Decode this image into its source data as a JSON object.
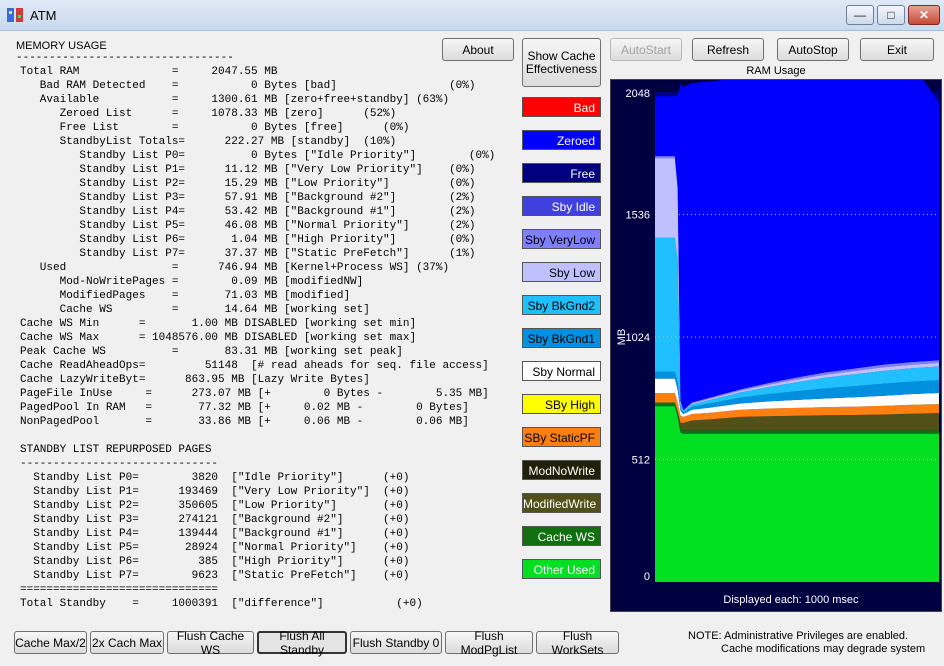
{
  "window": {
    "title": "ATM",
    "min_label": "—",
    "max_label": "□",
    "close_label": "✕"
  },
  "memory": {
    "title": "MEMORY USAGE",
    "underline": "---------------------------------",
    "lines": [
      "Total RAM              =     2047.55 MB",
      "   Bad RAM Detected    =           0 Bytes [bad]                 (0%)",
      "   Available           =     1300.61 MB [zero+free+standby] (63%)",
      "      Zeroed List      =     1078.33 MB [zero]      (52%)",
      "      Free List        =           0 Bytes [free]      (0%)",
      "      StandbyList Totals=      222.27 MB [standby]  (10%)",
      "         Standby List P0=          0 Bytes [\"Idle Priority\"]        (0%)",
      "         Standby List P1=      11.12 MB [\"Very Low Priority\"]    (0%)",
      "         Standby List P2=      15.29 MB [\"Low Priority\"]         (0%)",
      "         Standby List P3=      57.91 MB [\"Background #2\"]        (2%)",
      "         Standby List P4=      53.42 MB [\"Background #1\"]        (2%)",
      "         Standby List P5=      46.08 MB [\"Normal Priority\"]      (2%)",
      "         Standby List P6=       1.04 MB [\"High Priority\"]        (0%)",
      "         Standby List P7=      37.37 MB [\"Static PreFetch\"]      (1%)",
      "   Used                =      746.94 MB [Kernel+Process WS] (37%)",
      "      Mod-NoWritePages =        0.09 MB [modifiedNW]",
      "      ModifiedPages    =       71.03 MB [modified]",
      "      Cache WS         =       14.64 MB [working set]",
      "Cache WS Min      =       1.00 MB DISABLED [working set min]",
      "Cache WS Max      = 1048576.00 MB DISABLED [working set max]",
      "Peak Cache WS          =       83.31 MB [working set peak]",
      "Cache ReadAheadOps=         51148  [# read aheads for seq. file access]",
      "Cache LazyWriteByt=      863.95 MB [Lazy Write Bytes]",
      "PageFile InUse     =      273.07 MB [+        0 Bytes -        5.35 MB]",
      "PagedPool In RAM   =       77.32 MB [+     0.02 MB -        0 Bytes]",
      "NonPagedPool       =       33.86 MB [+     0.06 MB -        0.06 MB]"
    ]
  },
  "repurposed": {
    "title": "STANDBY LIST REPURPOSED PAGES",
    "underline": "------------------------------",
    "rows": [
      "  Standby List P0=        3820  [\"Idle Priority\"]      (+0)",
      "  Standby List P1=      193469  [\"Very Low Priority\"]  (+0)",
      "  Standby List P2=      350605  [\"Low Priority\"]       (+0)",
      "  Standby List P3=      274121  [\"Background #2\"]      (+0)",
      "  Standby List P4=      139444  [\"Background #1\"]      (+0)",
      "  Standby List P5=       28924  [\"Normal Priority\"]    (+0)",
      "  Standby List P6=         385  [\"High Priority\"]      (+0)",
      "  Standby List P7=        9623  [\"Static PreFetch\"]    (+0)"
    ],
    "separator": "==============================",
    "total": "Total Standby    =     1000391  [\"difference\"]           (+0)"
  },
  "buttons": {
    "about": "About",
    "show_cache": "Show Cache Effectiveness",
    "autostart": "AutoStart",
    "refresh": "Refresh",
    "autostop": "AutoStop",
    "exit": "Exit"
  },
  "legend": [
    {
      "label": "Bad",
      "bg": "#ff0000",
      "fg": "#ffffff"
    },
    {
      "label": "Zeroed",
      "bg": "#0000ff",
      "fg": "#ffffff"
    },
    {
      "label": "Free",
      "bg": "#000080",
      "fg": "#ffffff"
    },
    {
      "label": "Sby Idle",
      "bg": "#4040e0",
      "fg": "#ffffff"
    },
    {
      "label": "Sby VeryLow",
      "bg": "#8080ff",
      "fg": "#000000"
    },
    {
      "label": "Sby Low",
      "bg": "#c0c0ff",
      "fg": "#000000"
    },
    {
      "label": "Sby BkGnd2",
      "bg": "#20c0ff",
      "fg": "#000000"
    },
    {
      "label": "Sby BkGnd1",
      "bg": "#0090e0",
      "fg": "#000000"
    },
    {
      "label": "Sby Normal",
      "bg": "#ffffff",
      "fg": "#000000"
    },
    {
      "label": "SBy High",
      "bg": "#ffff00",
      "fg": "#000000"
    },
    {
      "label": "SBy StaticPF",
      "bg": "#ff8010",
      "fg": "#000000"
    },
    {
      "label": "ModNoWrite",
      "bg": "#202008",
      "fg": "#ffffff"
    },
    {
      "label": "ModifiedWrite",
      "bg": "#505018",
      "fg": "#ffffff"
    },
    {
      "label": "Cache WS",
      "bg": "#107010",
      "fg": "#ffffff"
    },
    {
      "label": "Other Used",
      "bg": "#00e020",
      "fg": "#ffffff"
    }
  ],
  "chart": {
    "title": "RAM Usage",
    "ylabel": "MB",
    "footer": "Displayed each: 1000 msec"
  },
  "chart_data": {
    "type": "area",
    "title": "RAM Usage",
    "ylabel": "MB",
    "ylim": [
      0,
      2048
    ],
    "yticks": [
      0,
      512,
      1024,
      1536,
      2048
    ],
    "x": [
      0,
      7,
      8,
      9,
      10,
      13,
      20,
      30,
      40,
      50,
      60,
      70,
      80,
      90,
      100
    ],
    "series": [
      {
        "name": "Other Used",
        "color": "#00e020",
        "values": [
          735,
          735,
          690,
          625,
          620,
          620,
          620,
          620,
          620,
          620,
          620,
          620,
          620,
          620,
          620
        ]
      },
      {
        "name": "Cache WS",
        "color": "#107010",
        "values": [
          15,
          15,
          15,
          15,
          15,
          15,
          15,
          15,
          15,
          15,
          15,
          15,
          15,
          15,
          15
        ]
      },
      {
        "name": "ModifiedWrite",
        "color": "#505018",
        "values": [
          0,
          0,
          5,
          25,
          30,
          40,
          45,
          55,
          58,
          60,
          62,
          63,
          65,
          68,
          71
        ]
      },
      {
        "name": "ModNoWrite",
        "color": "#202008",
        "values": [
          0,
          0,
          0,
          0,
          0,
          0,
          0,
          0,
          0,
          0,
          0,
          0,
          0,
          0,
          0
        ]
      },
      {
        "name": "SBy StaticPF",
        "color": "#ff8010",
        "values": [
          40,
          40,
          38,
          30,
          25,
          27,
          28,
          30,
          32,
          33,
          34,
          35,
          36,
          37,
          37
        ]
      },
      {
        "name": "SBy High",
        "color": "#ffff00",
        "values": [
          0,
          0,
          0,
          0,
          0,
          0,
          0,
          0,
          0,
          0,
          0,
          0,
          0,
          1,
          1
        ]
      },
      {
        "name": "Sby Normal",
        "color": "#ffffff",
        "values": [
          60,
          60,
          55,
          20,
          12,
          18,
          22,
          26,
          30,
          33,
          36,
          39,
          42,
          44,
          46
        ]
      },
      {
        "name": "Sby BkGnd1",
        "color": "#0090e0",
        "values": [
          30,
          30,
          28,
          8,
          6,
          12,
          18,
          24,
          30,
          36,
          42,
          46,
          50,
          52,
          53
        ]
      },
      {
        "name": "Sby BkGnd2",
        "color": "#20c0ff",
        "values": [
          560,
          560,
          510,
          20,
          6,
          10,
          15,
          22,
          30,
          38,
          45,
          50,
          54,
          56,
          58
        ]
      },
      {
        "name": "Sby Low",
        "color": "#c0c0ff",
        "values": [
          330,
          330,
          300,
          10,
          3,
          5,
          6,
          8,
          10,
          12,
          13,
          14,
          15,
          15,
          15
        ]
      },
      {
        "name": "Sby VeryLow",
        "color": "#8080ff",
        "values": [
          10,
          10,
          10,
          4,
          2,
          3,
          4,
          5,
          7,
          8,
          9,
          10,
          11,
          11,
          11
        ]
      },
      {
        "name": "Sby Idle",
        "color": "#4040e0",
        "values": [
          0,
          0,
          0,
          0,
          0,
          0,
          0,
          0,
          0,
          0,
          0,
          0,
          0,
          0,
          0
        ]
      },
      {
        "name": "Free",
        "color": "#000080",
        "values": [
          0,
          0,
          0,
          0,
          0,
          0,
          0,
          0,
          0,
          0,
          0,
          0,
          0,
          0,
          0
        ]
      },
      {
        "name": "Zeroed",
        "color": "#0000ff",
        "values": [
          250,
          250,
          380,
          1325,
          1350,
          1335,
          1320,
          1302,
          1290,
          1280,
          1270,
          1265,
          1258,
          1255,
          1078
        ]
      },
      {
        "name": "Bad",
        "color": "#ff0000",
        "values": [
          0,
          0,
          0,
          0,
          0,
          0,
          0,
          0,
          0,
          0,
          0,
          0,
          0,
          0,
          0
        ]
      }
    ]
  },
  "bottom_buttons": [
    "Cache Max/2",
    "2x Cach Max",
    "Flush Cache WS",
    "Flush All Standby",
    "Flush Standby 0",
    "Flush ModPgList",
    "Flush WorkSets"
  ],
  "note": {
    "line1": "NOTE: Administrative Privileges are enabled.",
    "line2": "Cache modifications may degrade system"
  }
}
